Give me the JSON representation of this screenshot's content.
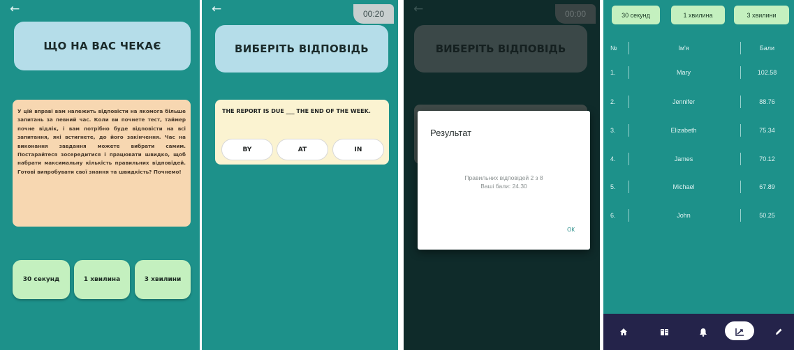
{
  "screen1": {
    "title": "ЩО НА ВАС ЧЕКАЄ",
    "intro": "У цій вправі вам належить відповісти на якомога більше запитань за певний час. Коли ви почнете тест, таймер почне відлік, і вам потрібно буде відповісти на всі запитання, які встигнете, до його закінчення. Час на виконання завдання можете вибрати самим. Постарайтеся зосередитися і працювати швидко, щоб набрати максимальну кількість правильних відповідей. Готові випробувати свої знання та швидкість? Почнемо!",
    "buttons": [
      "30 секунд",
      "1 хвилина",
      "3 хвилини"
    ]
  },
  "screen2": {
    "timer": "00:20",
    "title": "ВИБЕРІТЬ ВІДПОВІДЬ",
    "question": "THE REPORT IS DUE ___ THE END OF THE WEEK.",
    "answers": [
      "BY",
      "AT",
      "IN"
    ]
  },
  "screen3": {
    "timer": "00:00",
    "title": "ВИБЕРІТЬ ВІДПОВІДЬ",
    "dialog": {
      "title": "Результат",
      "line1": "Правильних відповідей 2 з 8",
      "line2": "Ваші бали: 24.30",
      "ok": "ОК"
    }
  },
  "leaderboard": {
    "filters": [
      "30 секунд",
      "1 хвилина",
      "3 хвилини"
    ],
    "headers": {
      "num": "№",
      "name": "Ім'я",
      "score": "Бали"
    },
    "rows": [
      {
        "num": "1.",
        "name": "Mary",
        "score": "102.58"
      },
      {
        "num": "2.",
        "name": "Jennifer",
        "score": "88.76"
      },
      {
        "num": "3.",
        "name": "Elizabeth",
        "score": "75.34"
      },
      {
        "num": "4.",
        "name": "James",
        "score": "70.12"
      },
      {
        "num": "5.",
        "name": "Michael",
        "score": "67.89"
      },
      {
        "num": "6.",
        "name": "John",
        "score": "50.25"
      }
    ],
    "nav_icons": [
      "home-icon",
      "book-icon",
      "bell-icon",
      "chart-icon",
      "pencil-icon"
    ],
    "active_nav": "chart-icon"
  },
  "colors": {
    "teal": "#1d918a",
    "green_button": "#c4f0bf",
    "title_blue": "#b5dde9",
    "intro_peach": "#f7d7b1",
    "question_cream": "#fbf3d1",
    "nav_dark": "#24234a"
  }
}
